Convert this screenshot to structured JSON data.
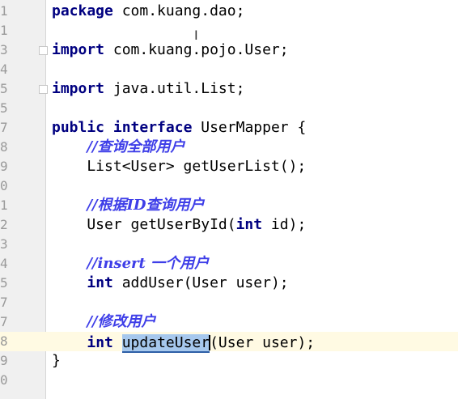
{
  "editor": {
    "lines": [
      {
        "num": "1",
        "parts": [
          {
            "t": "package",
            "k": "kw"
          },
          {
            "t": " com.kuang.dao;",
            "k": ""
          }
        ]
      },
      {
        "num": "1",
        "parts": []
      },
      {
        "num": "3",
        "parts": [
          {
            "t": "import",
            "k": "kw"
          },
          {
            "t": " com.kuang.pojo.User;",
            "k": ""
          }
        ]
      },
      {
        "num": "4",
        "parts": []
      },
      {
        "num": "5",
        "parts": [
          {
            "t": "import",
            "k": "kw"
          },
          {
            "t": " java.util.List;",
            "k": ""
          }
        ]
      },
      {
        "num": "5",
        "parts": []
      },
      {
        "num": "7",
        "parts": [
          {
            "t": "public",
            "k": "kw"
          },
          {
            "t": " ",
            "k": ""
          },
          {
            "t": "interface",
            "k": "kw"
          },
          {
            "t": " UserMapper {",
            "k": ""
          }
        ]
      },
      {
        "num": "8",
        "parts": [
          {
            "t": "    ",
            "k": ""
          },
          {
            "t": "//查询全部用户",
            "k": "cm"
          }
        ]
      },
      {
        "num": "9",
        "parts": [
          {
            "t": "    List<User> getUserList();",
            "k": ""
          }
        ]
      },
      {
        "num": "0",
        "parts": []
      },
      {
        "num": "1",
        "parts": [
          {
            "t": "    ",
            "k": ""
          },
          {
            "t": "//根据ID查询用户",
            "k": "cm"
          }
        ]
      },
      {
        "num": "2",
        "parts": [
          {
            "t": "    User getUserById(",
            "k": ""
          },
          {
            "t": "int",
            "k": "kw"
          },
          {
            "t": " id);",
            "k": ""
          }
        ]
      },
      {
        "num": "3",
        "parts": []
      },
      {
        "num": "4",
        "parts": [
          {
            "t": "    ",
            "k": ""
          },
          {
            "t": "//insert 一个用户",
            "k": "cm"
          }
        ]
      },
      {
        "num": "5",
        "parts": [
          {
            "t": "    ",
            "k": ""
          },
          {
            "t": "int",
            "k": "kw"
          },
          {
            "t": " addUser(User user);",
            "k": ""
          }
        ]
      },
      {
        "num": "7",
        "parts": []
      },
      {
        "num": "7",
        "parts": [
          {
            "t": "    ",
            "k": ""
          },
          {
            "t": "//修改用户",
            "k": "cm"
          }
        ]
      },
      {
        "num": "8",
        "parts": [
          {
            "t": "    ",
            "k": ""
          },
          {
            "t": "int",
            "k": "kw"
          },
          {
            "t": " ",
            "k": ""
          },
          {
            "t": "updateUser",
            "k": "sel"
          },
          {
            "t": "(User user);",
            "k": ""
          }
        ],
        "current": true
      },
      {
        "num": "9",
        "parts": [
          {
            "t": "}",
            "k": ""
          }
        ]
      },
      {
        "num": "0",
        "parts": []
      }
    ]
  }
}
